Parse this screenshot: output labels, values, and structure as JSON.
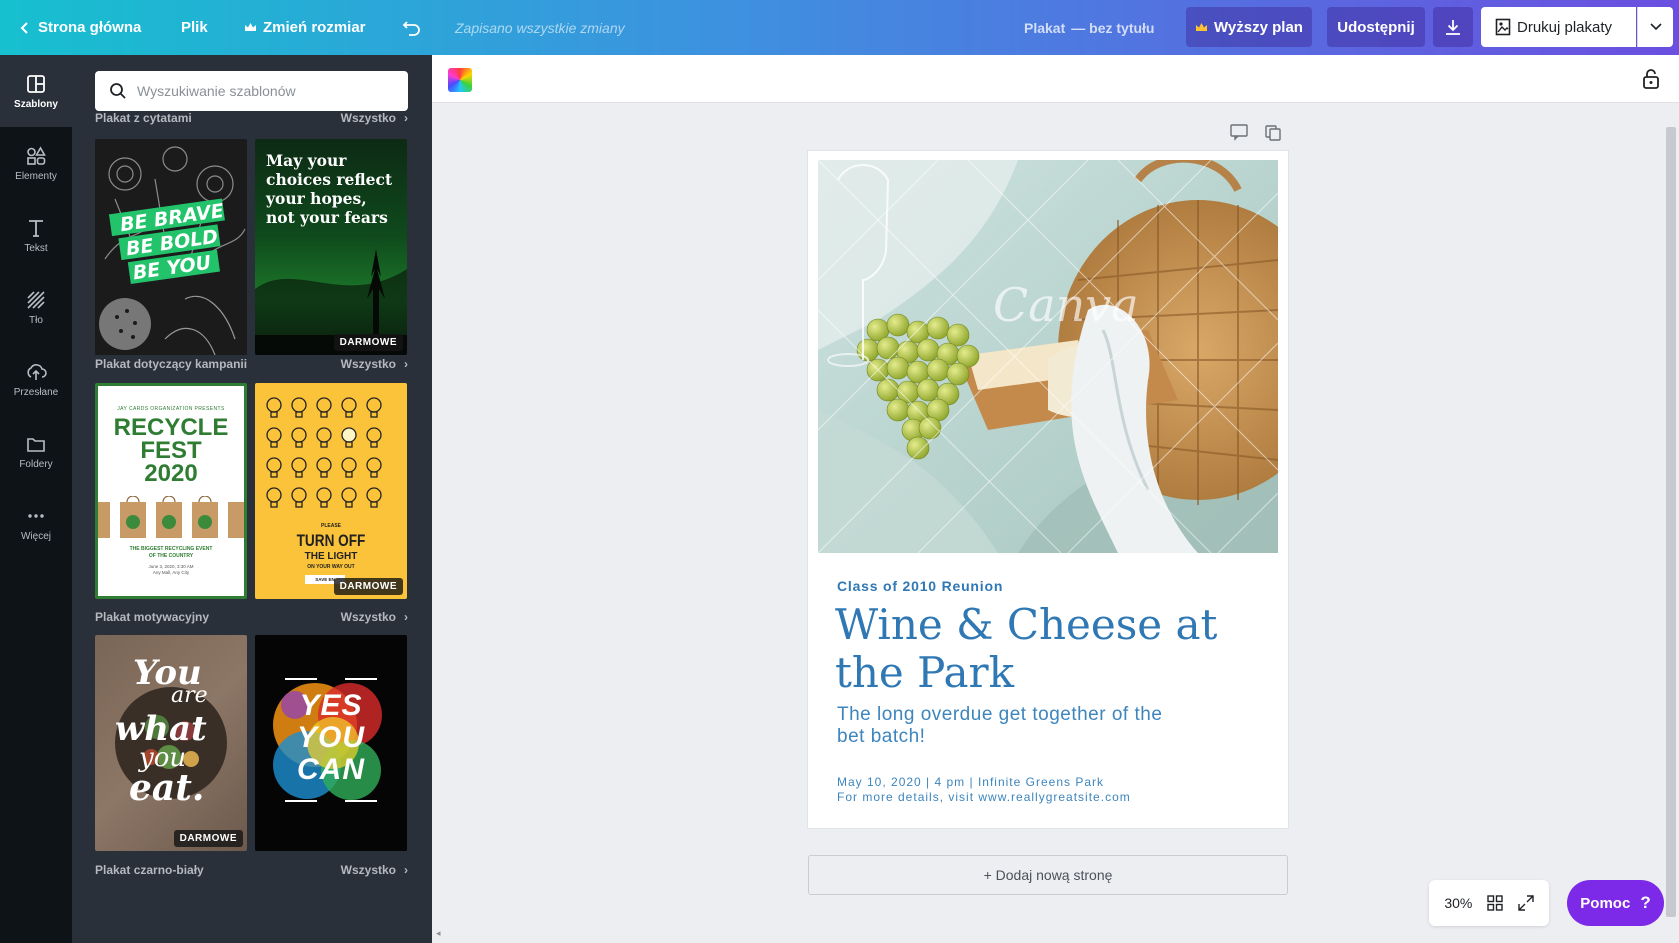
{
  "topbar": {
    "home": "Strona główna",
    "file": "Plik",
    "resize": "Zmień rozmiar",
    "saved": "Zapisano wszystkie zmiany",
    "doc_type": "Plakat",
    "doc_title": "— bez tytułu",
    "upgrade": "Wyższy plan",
    "share": "Udostępnij",
    "print": "Drukuj plakaty"
  },
  "rail": [
    {
      "label": "Szablony",
      "icon": "templates-icon"
    },
    {
      "label": "Elementy",
      "icon": "elements-icon"
    },
    {
      "label": "Tekst",
      "icon": "text-icon"
    },
    {
      "label": "Tło",
      "icon": "background-icon"
    },
    {
      "label": "Przesłane",
      "icon": "upload-icon"
    },
    {
      "label": "Foldery",
      "icon": "folder-icon"
    },
    {
      "label": "Więcej",
      "icon": "more-icon"
    }
  ],
  "panel": {
    "search_placeholder": "Wyszukiwanie szablonów",
    "see_all": "Wszystko",
    "badge_free": "DARMOWE",
    "sections": [
      {
        "title": "Plakat z cytatami"
      },
      {
        "title": "Plakat dotyczący kampanii"
      },
      {
        "title": "Plakat motywacyjny"
      },
      {
        "title": "Plakat czarno-biały"
      }
    ],
    "t1": {
      "l1": "BE BRAVE",
      "l2": "BE BOLD",
      "l3": "BE YOU"
    },
    "t2": {
      "text": "May your choices reflect your hopes, not your fears"
    },
    "t3": {
      "small": "JAY CARDS ORGANIZATION PRESENTS",
      "l1": "RECYCLE",
      "l2": "FEST",
      "l3": "2020",
      "foot": "THE BIGGEST RECYCLING EVENT OF THE COUNTRY",
      "date": "June 3, 2020, 3:30 AM",
      "place": "Any Mall, Any City"
    },
    "t4": {
      "please": "PLEASE",
      "l1": "TURN OFF",
      "l2": "THE LIGHT",
      "l3": "ON YOUR WAY OUT",
      "foot": "SAVE EN"
    },
    "t5": {
      "l1": "You",
      "l2": "are",
      "l3": "what",
      "l4": "you",
      "l5": "eat."
    },
    "t6": {
      "l1": "YES",
      "l2": "YOU",
      "l3": "CAN"
    }
  },
  "poster": {
    "watermark": "Canva",
    "class_line": "Class of 2010 Reunion",
    "title": "Wine & Cheese at the Park",
    "subtitle": "The long overdue get together of the bet batch!",
    "details1": "May 10, 2020 | 4 pm | Infinite Greens Park",
    "details2": "For more details, visit www.reallygreatsite.com"
  },
  "add_page": "+ Dodaj nową stronę",
  "zoom": {
    "level": "30%"
  },
  "help": {
    "label": "Pomoc",
    "icon": "?"
  },
  "colors": {
    "accent": "#7d2ae8",
    "poster_blue": "#2f78b4",
    "panel_bg": "#293039",
    "rail_bg": "#0e1318"
  }
}
